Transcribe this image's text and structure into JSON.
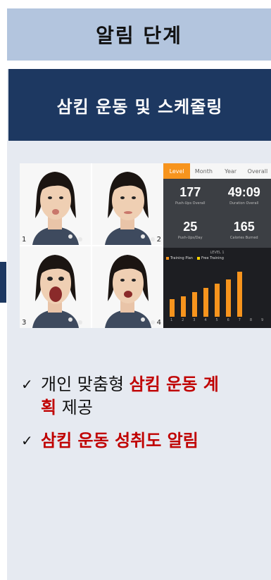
{
  "title": "알림 단계",
  "subtitle": "삼킴 운동 및 스케줄링",
  "photos": [
    {
      "number": "1"
    },
    {
      "number": "2"
    },
    {
      "number": "3"
    },
    {
      "number": "4"
    }
  ],
  "app": {
    "tabs": [
      "Level",
      "Month",
      "Year",
      "Overall"
    ],
    "active_tab": "Level",
    "stats": [
      {
        "value": "177",
        "label": "Push-Ups Overall"
      },
      {
        "value": "49:09",
        "label": "Duration Overall"
      },
      {
        "value": "25",
        "label": "Push-Ups/Day"
      },
      {
        "value": "165",
        "label": "Calories Burned"
      }
    ],
    "chart_level": "LEVEL 1",
    "legend": [
      "Training Plan",
      "Free Training"
    ]
  },
  "chart_data": {
    "type": "bar",
    "categories": [
      "1",
      "2",
      "3",
      "4",
      "5",
      "6",
      "7",
      "8",
      "9"
    ],
    "values": [
      2.4,
      2.8,
      3.4,
      4.0,
      4.6,
      5.2,
      6.2,
      0,
      0
    ],
    "ylim": [
      0,
      7
    ],
    "colors": {
      "bar": "#f7941d",
      "legend_training_plan": "#f7941d",
      "legend_free_training": "#ffd400"
    }
  },
  "bullets": [
    {
      "check": "✓",
      "parts": [
        {
          "text": "개인 맞춤형 ",
          "hl": false
        },
        {
          "text": "삼킴 운동 계획",
          "hl": true
        },
        {
          "text": " 제공",
          "hl": false
        }
      ]
    },
    {
      "check": "✓",
      "parts": [
        {
          "text": "삼킴 운동 성취도 알림",
          "hl": true
        }
      ]
    }
  ],
  "colors": {
    "title_bg": "#b3c5de",
    "subtitle_bg": "#1d3861",
    "panel_bg": "#e6eaf1",
    "highlight": "#c00000",
    "accent": "#f7941d"
  }
}
